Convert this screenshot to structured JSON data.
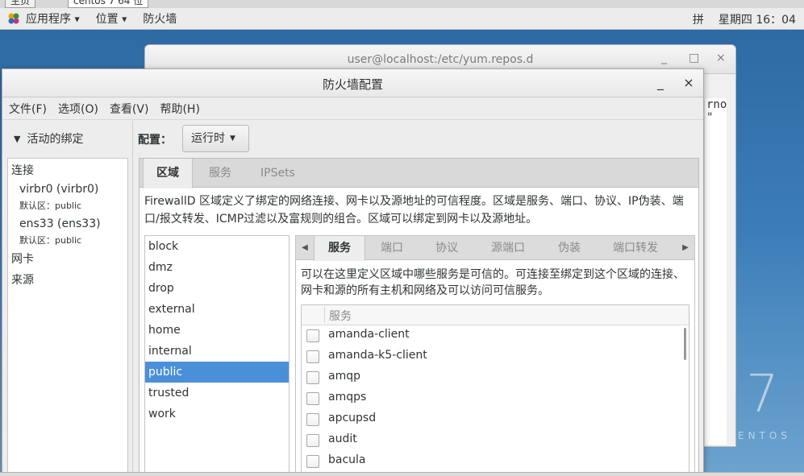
{
  "host_tabs": [
    "主页",
    "centos 7 64 位"
  ],
  "topbar": {
    "apps_label": "应用程序",
    "places_label": "位置",
    "active_app": "防火墙",
    "input_method": "拼",
    "clock": "星期四 16：04"
  },
  "terminal": {
    "title": "user@localhost:/etc/yum.repos.d",
    "min": "_",
    "max": "□",
    "close": "×",
    "text_line1": "rno",
    "text_line2": "\""
  },
  "dialog": {
    "title": "防火墙配置",
    "min": "_",
    "close": "×",
    "menus": [
      "文件(F)",
      "选项(O)",
      "查看(V)",
      "帮助(H)"
    ],
    "active_bindings_label": "活动的绑定",
    "bindings": {
      "connections_header": "连接",
      "connections": [
        {
          "name": "virbr0 (virbr0)",
          "zone": "默认区：public"
        },
        {
          "name": "ens33 (ens33)",
          "zone": "默认区：public"
        }
      ],
      "nic_header": "网卡",
      "source_header": "来源"
    },
    "config_label": "配置：",
    "config_value": "运行时",
    "tabs": [
      "区域",
      "服务",
      "IPSets"
    ],
    "zone_description": "FirewallD 区域定义了绑定的网络连接、网卡以及源地址的可信程度。区域是服务、端口、协议、IP伪装、端口/报文转发、ICMP过滤以及富规则的组合。区域可以绑定到网卡以及源地址。",
    "zones": [
      "block",
      "dmz",
      "drop",
      "external",
      "home",
      "internal",
      "public",
      "trusted",
      "work"
    ],
    "selected_zone": "public",
    "subtabs": [
      "服务",
      "端口",
      "协议",
      "源端口",
      "伪装",
      "端口转发"
    ],
    "services_description": "可以在这里定义区域中哪些服务是可信的。可连接至绑定到这个区域的连接、网卡和源的所有主机和网络及可以访问可信服务。",
    "services_header": "服务",
    "services": [
      "amanda-client",
      "amanda-k5-client",
      "amqp",
      "amqps",
      "apcupsd",
      "audit",
      "bacula"
    ]
  },
  "desktop": {
    "logo_numeral": "7",
    "logo_text": "ENTOS"
  }
}
